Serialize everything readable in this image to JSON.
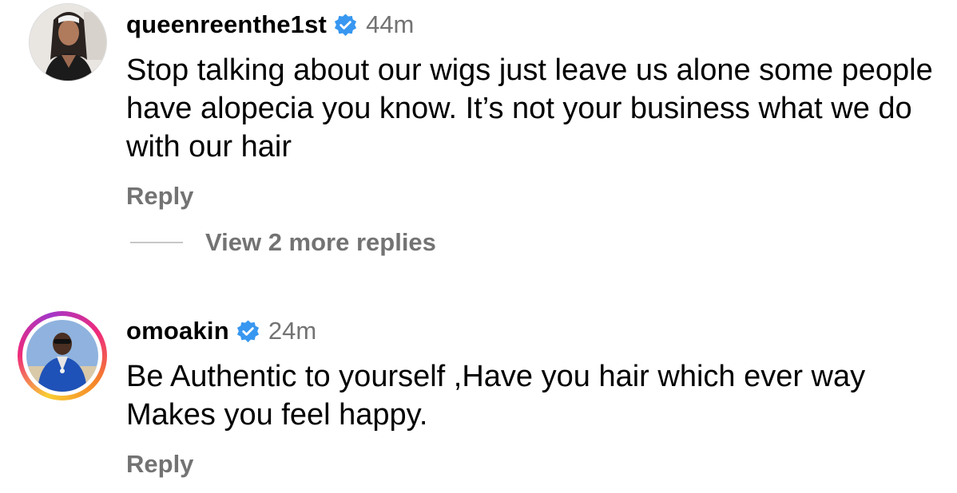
{
  "colors": {
    "text": "#000000",
    "secondary": "#737373",
    "verified": "#3897f0",
    "ring_gradient": [
      "#f9ce34",
      "#ee2a7b",
      "#a336c9"
    ]
  },
  "comments": [
    {
      "username": "queenreenthe1st",
      "verified": true,
      "time": "44m",
      "text": "Stop talking about our wigs just leave us alone some people have alopecia you know. It’s not your business what we do with our hair",
      "reply_label": "Reply",
      "view_replies_label": "View 2 more replies",
      "avatar_icon": "profile-photo"
    },
    {
      "username": "omoakin",
      "verified": true,
      "time": "24m",
      "text": "Be Authentic to yourself ,Have you hair which ever way Makes you feel happy.",
      "reply_label": "Reply",
      "avatar_icon": "profile-photo-story-ring"
    }
  ]
}
